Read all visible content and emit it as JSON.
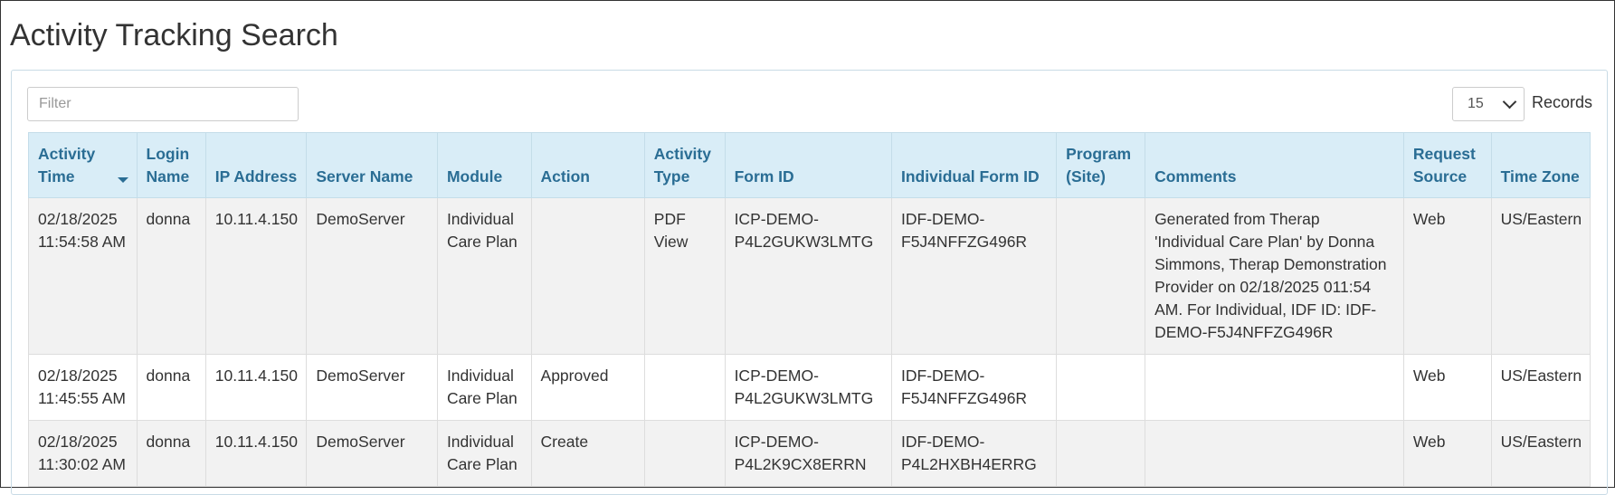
{
  "page": {
    "title": "Activity Tracking Search"
  },
  "filter": {
    "placeholder": "Filter",
    "value": ""
  },
  "records": {
    "selected": "15",
    "label": "Records"
  },
  "table": {
    "columns": [
      {
        "key": "activity_time",
        "line1": "Activity",
        "line2": "Time",
        "sorted": "desc"
      },
      {
        "key": "login_name",
        "line1": "Login",
        "line2": "Name"
      },
      {
        "key": "ip_address",
        "line1": "",
        "line2": "IP Address"
      },
      {
        "key": "server_name",
        "line1": "",
        "line2": "Server Name"
      },
      {
        "key": "module",
        "line1": "",
        "line2": "Module"
      },
      {
        "key": "action",
        "line1": "",
        "line2": "Action"
      },
      {
        "key": "activity_type",
        "line1": "Activity",
        "line2": "Type"
      },
      {
        "key": "form_id",
        "line1": "",
        "line2": "Form ID"
      },
      {
        "key": "individual_form_id",
        "line1": "",
        "line2": "Individual Form ID"
      },
      {
        "key": "program_site",
        "line1": "Program",
        "line2": "(Site)"
      },
      {
        "key": "comments",
        "line1": "",
        "line2": "Comments"
      },
      {
        "key": "request_source",
        "line1": "Request",
        "line2": "Source"
      },
      {
        "key": "time_zone",
        "line1": "",
        "line2": "Time Zone"
      }
    ],
    "rows": [
      {
        "activity_time": [
          "02/18/2025",
          "11:54:58 AM"
        ],
        "login_name": [
          "donna"
        ],
        "ip_address": [
          "10.11.4.150"
        ],
        "server_name": [
          "DemoServer"
        ],
        "module": [
          "Individual",
          "Care Plan"
        ],
        "action": [],
        "activity_type": [
          "PDF",
          "View"
        ],
        "form_id": [
          "ICP-DEMO-",
          "P4L2GUKW3LMTG"
        ],
        "individual_form_id": [
          "IDF-DEMO-",
          "F5J4NFFZG496R"
        ],
        "program_site": [],
        "comments": [
          "Generated from Therap",
          "'Individual Care Plan' by Donna",
          "Simmons, Therap Demonstration",
          "Provider on 02/18/2025 011:54",
          "AM. For Individual, IDF ID: IDF-",
          "DEMO-F5J4NFFZG496R"
        ],
        "request_source": [
          "Web"
        ],
        "time_zone": [
          "US/Eastern"
        ]
      },
      {
        "activity_time": [
          "02/18/2025",
          "11:45:55 AM"
        ],
        "login_name": [
          "donna"
        ],
        "ip_address": [
          "10.11.4.150"
        ],
        "server_name": [
          "DemoServer"
        ],
        "module": [
          "Individual",
          "Care Plan"
        ],
        "action": [
          "Approved"
        ],
        "activity_type": [],
        "form_id": [
          "ICP-DEMO-",
          "P4L2GUKW3LMTG"
        ],
        "individual_form_id": [
          "IDF-DEMO-",
          "F5J4NFFZG496R"
        ],
        "program_site": [],
        "comments": [],
        "request_source": [
          "Web"
        ],
        "time_zone": [
          "US/Eastern"
        ]
      },
      {
        "activity_time": [
          "02/18/2025",
          "11:30:02 AM"
        ],
        "login_name": [
          "donna"
        ],
        "ip_address": [
          "10.11.4.150"
        ],
        "server_name": [
          "DemoServer"
        ],
        "module": [
          "Individual",
          "Care Plan"
        ],
        "action": [
          "Create"
        ],
        "activity_type": [],
        "form_id": [
          "ICP-DEMO-",
          "P4L2K9CX8ERRN"
        ],
        "individual_form_id": [
          "IDF-DEMO-",
          "P4L2HXBH4ERRG"
        ],
        "program_site": [],
        "comments": [],
        "request_source": [
          "Web"
        ],
        "time_zone": [
          "US/Eastern"
        ]
      }
    ]
  },
  "colors": {
    "header_bg": "#d9edf7",
    "header_text": "#2a6d94",
    "odd_row_bg": "#f2f2f2",
    "even_row_bg": "#ffffff",
    "text": "#333333"
  }
}
